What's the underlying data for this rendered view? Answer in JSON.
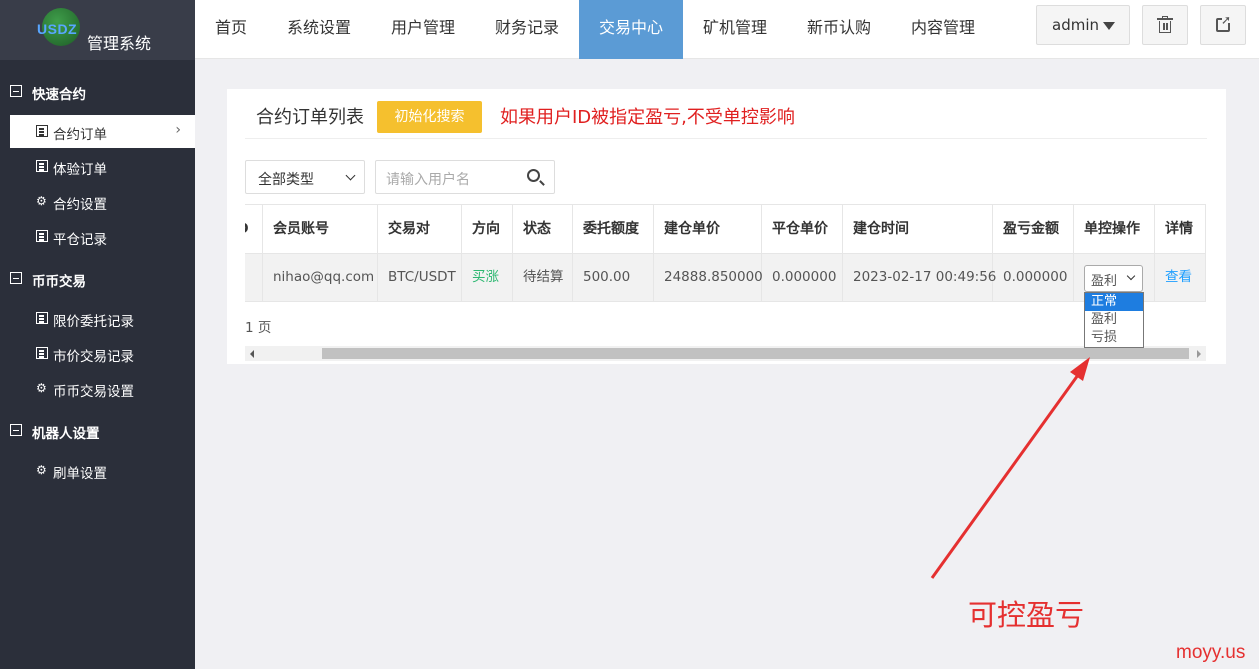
{
  "logo": {
    "brand": "USDZ",
    "title": "管理系统"
  },
  "header": {
    "tabs": [
      {
        "label": "首页"
      },
      {
        "label": "系统设置"
      },
      {
        "label": "用户管理"
      },
      {
        "label": "财务记录"
      },
      {
        "label": "交易中心"
      },
      {
        "label": "矿机管理"
      },
      {
        "label": "新币认购"
      },
      {
        "label": "内容管理"
      }
    ],
    "active_tab": "交易中心",
    "user": "admin"
  },
  "sidebar": {
    "groups": [
      {
        "label": "快速合约",
        "items": [
          {
            "label": "合约订单",
            "icon": "doc-icon",
            "active": true
          },
          {
            "label": "体验订单",
            "icon": "doc-icon"
          },
          {
            "label": "合约设置",
            "icon": "gear-icon"
          },
          {
            "label": "平仓记录",
            "icon": "doc-icon"
          }
        ]
      },
      {
        "label": "币币交易",
        "items": [
          {
            "label": "限价委托记录",
            "icon": "doc-icon"
          },
          {
            "label": "市价交易记录",
            "icon": "doc-icon"
          },
          {
            "label": "币币交易设置",
            "icon": "gear-icon"
          }
        ]
      },
      {
        "label": "机器人设置",
        "items": [
          {
            "label": "刷单设置",
            "icon": "gear-icon"
          }
        ]
      }
    ]
  },
  "panel": {
    "title": "合约订单列表",
    "init_button": "初始化搜索",
    "warning": "如果用户ID被指定盈亏,不受单控影响",
    "type_select": "全部类型",
    "search_placeholder": "请输入用户名",
    "columns": [
      "D",
      "会员账号",
      "交易对",
      "方向",
      "状态",
      "委托额度",
      "建仓单价",
      "平仓单价",
      "建仓时间",
      "盈亏金额",
      "单控操作",
      "详情"
    ],
    "rows": [
      {
        "id": "",
        "account": "nihao@qq.com",
        "pair": "BTC/USDT",
        "direction": "买涨",
        "status": "待结算",
        "amount": "500.00",
        "open_price": "24888.850000",
        "close_price": "0.000000",
        "open_time": "2023-02-17 00:49:56",
        "pnl": "0.000000",
        "control": "盈利",
        "detail": "查看"
      }
    ],
    "control_options": [
      "正常",
      "盈利",
      "亏损"
    ],
    "control_highlighted": "正常",
    "pager": "1 页"
  },
  "annotation": {
    "text": "可控盈亏",
    "color": "#e53030"
  },
  "watermark": "moyy.us",
  "colors": {
    "sidebar": "#2b2f3a",
    "active_tab": "#5b9bd5",
    "init_button": "#f5c02e",
    "warning": "#e02020"
  }
}
